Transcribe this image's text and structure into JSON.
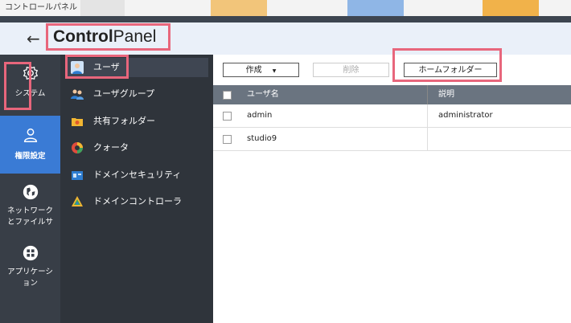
{
  "window": {
    "title": "コントロールパネル"
  },
  "header": {
    "back_glyph": "←",
    "brand_bold": "Control",
    "brand_light": "Panel"
  },
  "leftnav": {
    "items": [
      {
        "label": "システム",
        "icon": "gear-icon"
      },
      {
        "label": "権限設定",
        "icon": "user-icon"
      },
      {
        "label_line1": "ネットワーク",
        "label_line2": "とファイルサ",
        "icon": "globe-icon"
      },
      {
        "label_line1": "アプリケーシ",
        "label_line2": "ョン",
        "icon": "apps-icon"
      }
    ]
  },
  "subnav": {
    "items": [
      {
        "label": "ユーザ",
        "icon": "user-icon"
      },
      {
        "label": "ユーザグループ",
        "icon": "user-group-icon"
      },
      {
        "label": "共有フォルダー",
        "icon": "shared-folder-icon"
      },
      {
        "label": "クォータ",
        "icon": "quota-icon"
      },
      {
        "label": "ドメインセキュリティ",
        "icon": "domain-security-icon"
      },
      {
        "label": "ドメインコントローラ",
        "icon": "domain-controller-icon"
      }
    ]
  },
  "toolbar": {
    "create_label": "作成",
    "create_arrow": "▼",
    "delete_label": "削除",
    "home_folder_label": "ホームフォルダー"
  },
  "table": {
    "columns": [
      "ユーザ名",
      "説明"
    ],
    "rows": [
      {
        "username": "admin",
        "description": "administrator"
      },
      {
        "username": "studio9",
        "description": ""
      }
    ]
  },
  "colors": {
    "highlight": "#e8667c",
    "accent": "#3a7bd5",
    "nav_bg": "#383e47",
    "subnav_bg": "#2f343b"
  }
}
